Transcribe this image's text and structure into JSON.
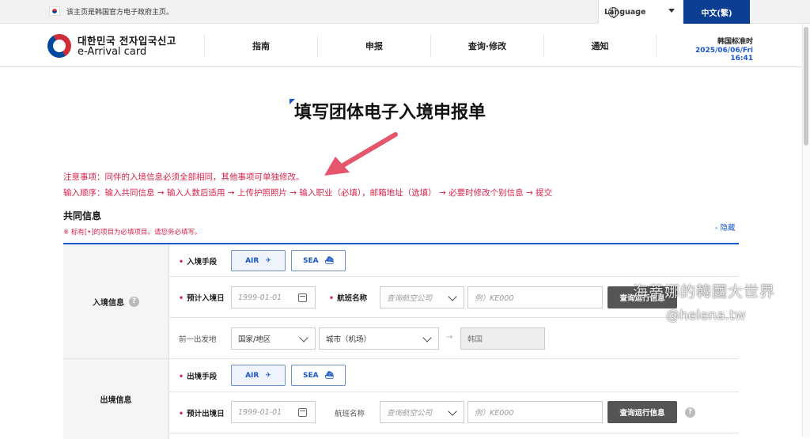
{
  "gov_bar": {
    "notice": "该主页是韩国官方电子政府主页。",
    "language_label": "Language",
    "current_language": "中文(繁)"
  },
  "header": {
    "brand_ko": "대한민국 전자입국신고",
    "brand_en": "e-Arrival card",
    "nav": [
      "指南",
      "申报",
      "查询·修改",
      "通知"
    ],
    "time_label": "韩国标准时",
    "time_value": "2025/06/06/Fri 16:41"
  },
  "page": {
    "title": "填写团体电子入境申报单",
    "caution": "注意事项：同伴的入境信息必须全部相同，其他事项可单独修改。",
    "order": "输入顺序：输入共同信息 → 输入人数后适用 → 上传护照照片 → 输入职业（必填），邮箱地址（选填） → 必要时修改个别信息 → 提交",
    "section_title": "共同信息",
    "required_note": "※ 标有[•]的项目为必填项目。请您务必填写。",
    "hide_link": "- 隐藏"
  },
  "entry": {
    "head": "入境信息",
    "mode_label": "入境手段",
    "air": "AIR",
    "sea": "SEA",
    "date_label": "预计入境日",
    "date_placeholder": "1999-01-01",
    "flight_label": "航班名称",
    "airline_placeholder": "查询航空公司",
    "flight_placeholder": "例）KE000",
    "search_btn": "查询运行信息",
    "prev_label": "前一出发地",
    "country": "国家/地区",
    "city": "城市（机场）",
    "dest": "韩国"
  },
  "exit": {
    "head": "出境信息",
    "mode_label": "出境手段",
    "air": "AIR",
    "sea": "SEA",
    "date_label": "预计出境日",
    "date_placeholder": "1999-01-01",
    "flight_label": "航班名称",
    "airline_placeholder": "查询航空公司",
    "flight_placeholder": "例）KE000",
    "search_btn": "查询运行信息"
  },
  "watermark": {
    "line1": "海蒂娜的韓國大世界",
    "line2": "@helena.tw"
  },
  "colors": {
    "brand_blue": "#1a57c9",
    "nav_blue": "#0b3d91",
    "alert_red": "#d9234a"
  }
}
